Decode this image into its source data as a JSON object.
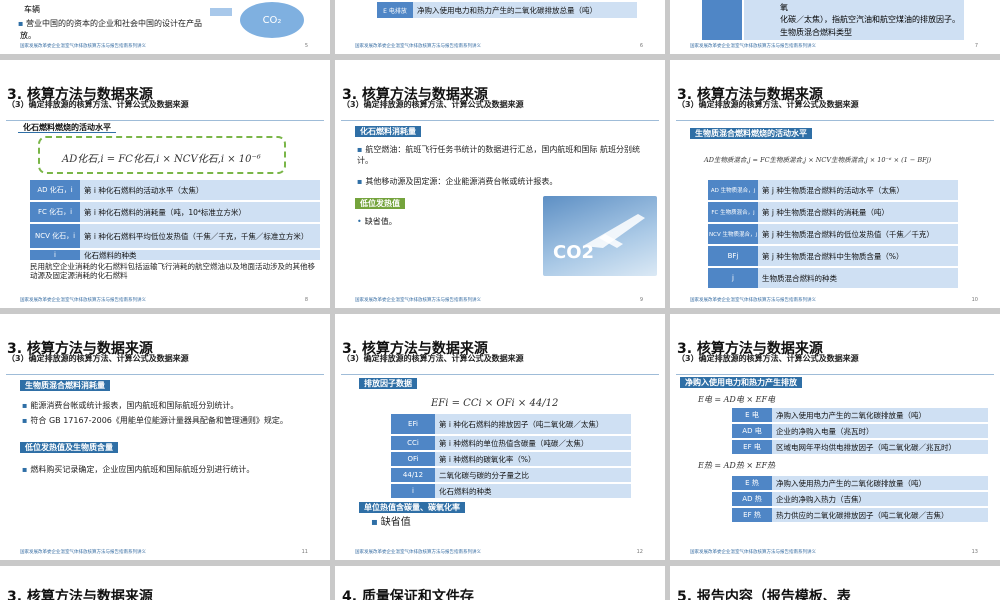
{
  "s1": {
    "top_text": "车辆",
    "bullet": "营业中国的的资本的企业和社会中国的设计在产品",
    "tail": "放。",
    "co2": "CO₂",
    "pg": "5"
  },
  "s2": {
    "key": "E 电排放",
    "val": "净购入使用电力和热力产生的二氧化碳排放总量（吨）",
    "pg": "6"
  },
  "s3": {
    "l1": "氧",
    "l2": "化碳／太焦），指航空汽油和航空煤油的排放因子。",
    "l3": "生物质混合燃料类型",
    "pg": "7"
  },
  "footer": "国家发展改革委企业温室气体排放核算方法与报告指南系列讲义",
  "title": "3. 核算方法与数据来源",
  "subtitle": "（3）确定排放源的核算方法、计算公式及数据来源",
  "s4": {
    "bar": "化石燃料燃烧的活动水平",
    "formula": "AD化石,i = FC化石,i × NCV化石,i × 10⁻⁶",
    "rows": [
      {
        "k": "AD 化石，i",
        "v": "第 i 种化石燃料的活动水平（太焦）"
      },
      {
        "k": "FC 化石，i",
        "v": "第 i 种化石燃料的消耗量（吨，10⁴标准立方米）"
      },
      {
        "k": "NCV 化石，i",
        "v": "第 i 种化石燃料平均低位发热值（千焦／千克，千焦／标准立方米）"
      },
      {
        "k": "i",
        "v": "化石燃料的种类"
      }
    ],
    "note": "民用航空企业消耗的化石燃料包括运输飞行消耗的航空燃油以及地面活动涉及的其他移动源及固定源消耗的化石燃料",
    "pg": "8"
  },
  "s5": {
    "bar1": "化石燃料消耗量",
    "b1": "航空燃油：航班飞行任务书统计的数据进行汇总，国内航班和国际 航班分别统计。",
    "b2": "其他移动源及固定源：企业能源消费台帐或统计报表。",
    "bar2": "低位发热值",
    "b3": "缺省值。",
    "img": "CO2",
    "pg": "9"
  },
  "s6": {
    "bar": "生物质混合燃料燃烧的活动水平",
    "formula": "AD生物质混合,j = FC生物质混合,j × NCV生物质混合,j × 10⁻⁶ × (1 − BFj)",
    "rows": [
      {
        "k": "AD 生物质混合，j",
        "v": "第 j 种生物质混合燃料的活动水平（太焦）"
      },
      {
        "k": "FC 生物质混合，j",
        "v": "第 j 种生物质混合燃料的消耗量（吨）"
      },
      {
        "k": "NCV 生物质混合，j",
        "v": "第 j 种生物质混合燃料的低位发热值（千焦／千克）"
      },
      {
        "k": "BFj",
        "v": "第 j 种生物质混合燃料中生物质含量（%）"
      },
      {
        "k": "j",
        "v": "生物质混合燃料的种类"
      }
    ],
    "pg": "10"
  },
  "s7": {
    "bar1": "生物质混合燃料消耗量",
    "b1": "能源消费台帐或统计报表，国内航班和国际航班分别统计。",
    "b2": "符合 GB 17167-2006《用能单位能源计量器具配备和管理通则》规定。",
    "bar2": "低位发热值及生物质含量",
    "b3": "燃料购买记录确定，企业应国内航班和国际航班分别进行统计。",
    "pg": "11"
  },
  "s8": {
    "bar1": "排放因子数据",
    "formula": "EFi = CCi × OFi × 44/12",
    "rows": [
      {
        "k": "EFi",
        "v": "第 i 种化石燃料的排放因子（吨二氧化碳／太焦）"
      },
      {
        "k": "CCi",
        "v": "第 i 种燃料的单位热值含碳量（吨碳／太焦）"
      },
      {
        "k": "OFi",
        "v": "第 i 种燃料的碳氧化率（%）"
      },
      {
        "k": "44/12",
        "v": "二氧化碳与碳的分子量之比"
      },
      {
        "k": "i",
        "v": "化石燃料的种类"
      }
    ],
    "bar2": "单位热值含碳量、碳氧化率",
    "b1": "缺省值",
    "pg": "12"
  },
  "s9": {
    "bar": "净购入使用电力和热力产生排放",
    "f1": "E电 = AD电 × EF电",
    "rows1": [
      {
        "k": "E 电",
        "v": "净购入使用电力产生的二氧化碳排放量（吨）"
      },
      {
        "k": "AD 电",
        "v": "企业的净购入电量（兆瓦时）"
      },
      {
        "k": "EF 电",
        "v": "区域电网年平均供电排放因子（吨二氧化碳／兆瓦时）"
      }
    ],
    "f2": "E热 = AD热 × EF热",
    "rows2": [
      {
        "k": "E 热",
        "v": "净购入使用热力产生的二氧化碳排放量（吨）"
      },
      {
        "k": "AD 热",
        "v": "企业的净购入热力（吉焦）"
      },
      {
        "k": "EF 热",
        "v": "热力供应的二氧化碳排放因子（吨二氧化碳／吉焦）"
      }
    ],
    "pg": "13"
  },
  "b1": {
    "title": "3. 核算方法与数据来源"
  },
  "b2": {
    "title": "4. 质量保证和文件存"
  },
  "b3": {
    "title": "5. 报告内容（报告模板、表"
  }
}
